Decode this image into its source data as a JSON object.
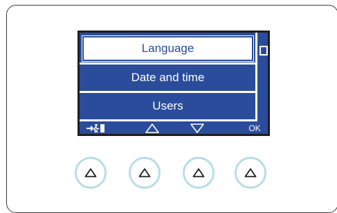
{
  "display": {
    "menu_items": [
      {
        "label": "Language",
        "selected": true
      },
      {
        "label": "Date and time",
        "selected": false
      },
      {
        "label": "Users",
        "selected": false
      }
    ],
    "softkeys": {
      "exit_icon": "exit-icon",
      "up_icon": "triangle-up-outline-icon",
      "down_icon": "triangle-down-outline-icon",
      "ok_label": "OK"
    }
  },
  "hardware_buttons": [
    {
      "icon": "triangle-up-icon"
    },
    {
      "icon": "triangle-up-icon"
    },
    {
      "icon": "triangle-up-icon"
    },
    {
      "icon": "triangle-up-icon"
    }
  ],
  "colors": {
    "display_blue": "#2b4c9b",
    "button_ring": "#b8dde6",
    "frame": "#3a3a3a"
  }
}
